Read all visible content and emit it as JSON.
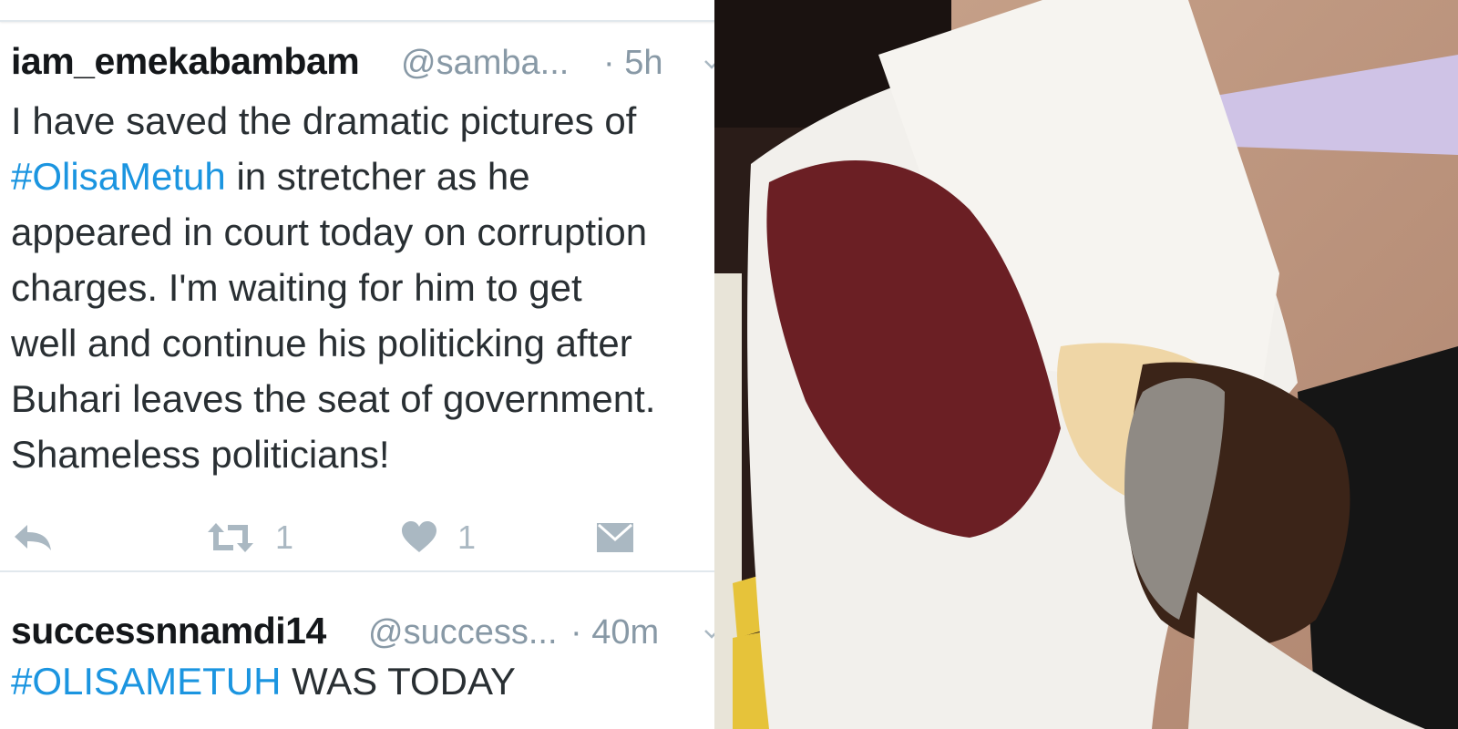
{
  "tweets": [
    {
      "username": "iam_emekabambam",
      "handle": "@samba...",
      "time": "· 5h",
      "text_lines": [
        {
          "pre": "I have saved the dramatic pictures of",
          "tag": "",
          "post": ""
        },
        {
          "pre": "",
          "tag": "#OlisaMetuh",
          "post": " in stretcher as he"
        },
        {
          "pre": "appeared in court today on corruption",
          "tag": "",
          "post": ""
        },
        {
          "pre": "charges. I'm waiting for him to get",
          "tag": "",
          "post": ""
        },
        {
          "pre": "well and continue his politicking after",
          "tag": "",
          "post": ""
        },
        {
          "pre": "Buhari leaves the seat of government.",
          "tag": "",
          "post": ""
        },
        {
          "pre": "Shameless politicians!",
          "tag": "",
          "post": ""
        }
      ],
      "retweet_count": "1",
      "like_count": "1"
    },
    {
      "username": "successnnamdi14",
      "handle": "@success...",
      "time": "· 40m",
      "tag": "#OLISAMETUH",
      "text": " WAS TODAY"
    }
  ],
  "icons": {
    "reply": "reply-icon",
    "retweet": "retweet-icon",
    "like": "heart-icon",
    "dm": "envelope-icon",
    "menu": "chevron-down-icon"
  },
  "colors": {
    "hashtag": "#1b95e0",
    "muted": "#aab8c2",
    "handle": "#8899a6",
    "text": "#292f33"
  }
}
